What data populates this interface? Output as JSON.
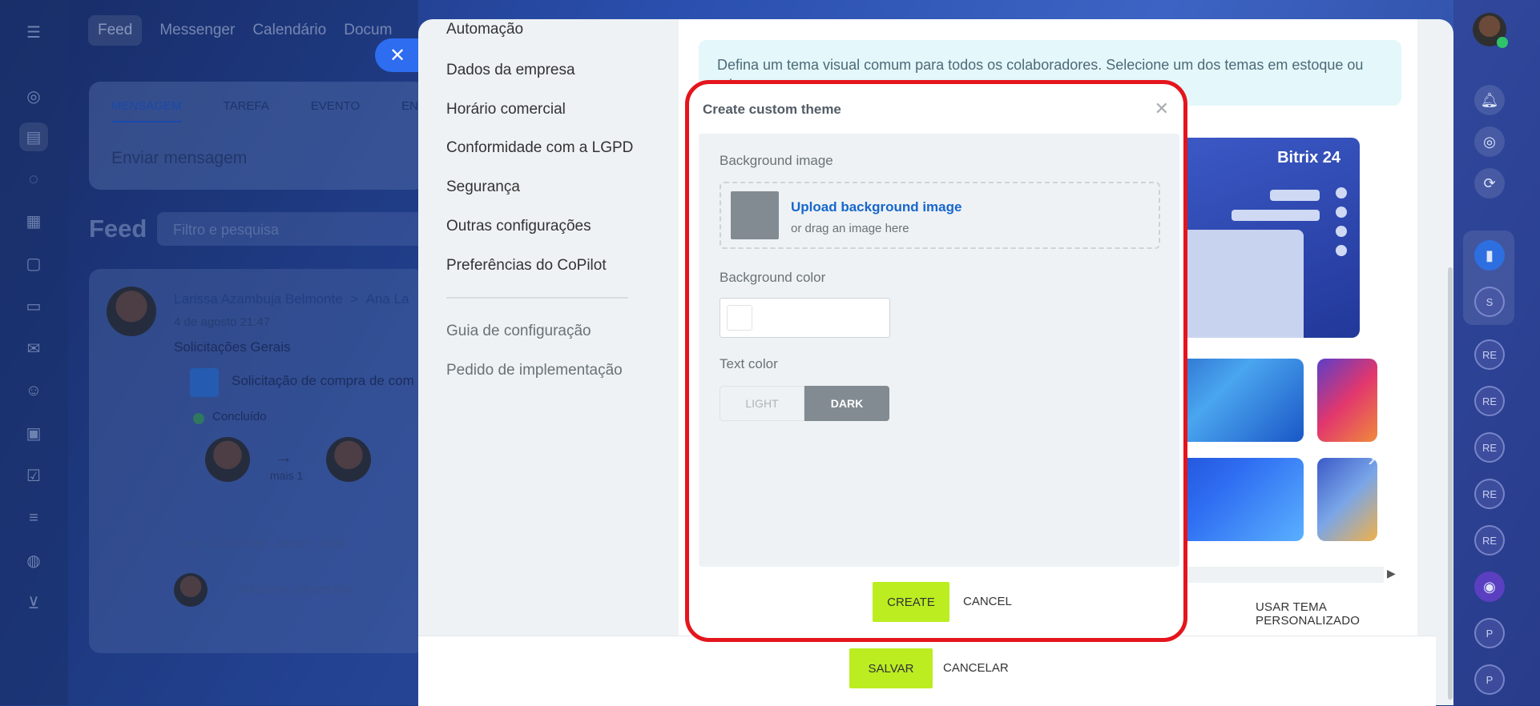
{
  "topbar": {
    "items": [
      "Feed",
      "Messenger",
      "Calendário",
      "Docum"
    ]
  },
  "message_card": {
    "tabs": [
      "MENSAGEM",
      "TAREFA",
      "EVENTO",
      "ENQ"
    ],
    "placeholder": "Enviar mensagem"
  },
  "feed": {
    "title": "Feed",
    "filter_placeholder": "Filtro e pesquisa"
  },
  "post": {
    "author": "Larissa Azambuja Belmonte",
    "recipient": "Ana La",
    "date": "4 de agosto 21:47",
    "title": "Solicitações Gerais",
    "subtitle": "Solicitação de compra de com",
    "status": "Concluído",
    "more": "mais 1",
    "actions": "Curtir   Comentar   Seguir   Mais",
    "comment_placeholder": "Adicionar comentário"
  },
  "settings_menu": {
    "items": [
      "Automação",
      "Dados da empresa",
      "Horário comercial",
      "Conformidade com a LGPD",
      "Segurança",
      "Outras configurações",
      "Preferências do CoPilot"
    ],
    "secondary": [
      "Guia de configuração",
      "Pedido de implementação"
    ]
  },
  "theme_panel": {
    "info": "Defina um tema visual comum para todos os colaboradores. Selecione um dos temas em estoque ou crie",
    "brand": "Bitrix 24",
    "use_custom": "USAR TEMA PERSONALIZADO"
  },
  "footer": {
    "save": "SALVAR",
    "cancel": "CANCELAR"
  },
  "modal": {
    "title": "Create custom theme",
    "bg_image_label": "Background image",
    "upload_link": "Upload background image",
    "upload_hint": "or drag an image here",
    "bg_color_label": "Background color",
    "text_color_label": "Text color",
    "light": "LIGHT",
    "dark": "DARK",
    "create": "CREATE",
    "cancel": "CANCEL"
  },
  "rail": {
    "badges": [
      "S",
      "RE",
      "RE",
      "RE",
      "RE",
      "RE",
      "P",
      "P"
    ]
  },
  "colors": {
    "accent_green": "#bbed21",
    "highlight_red": "#e4151c",
    "link_blue": "#1866cc"
  }
}
